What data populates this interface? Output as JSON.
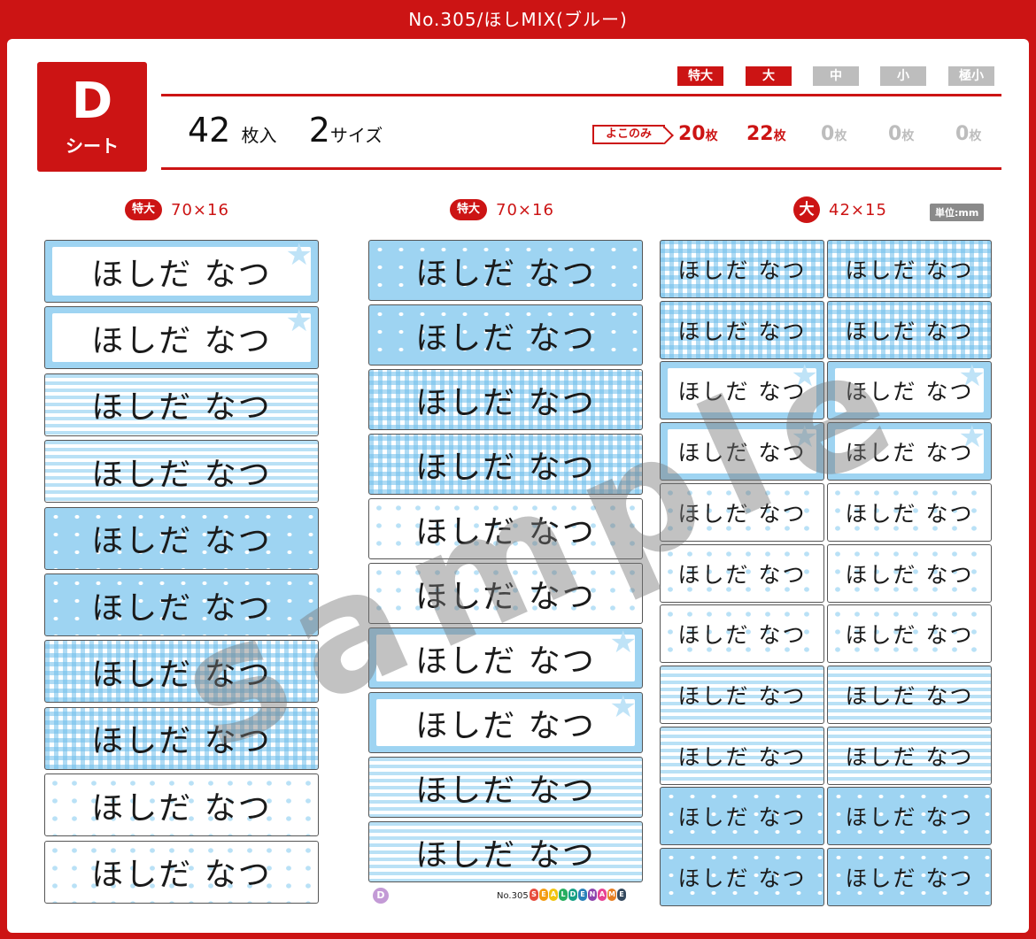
{
  "title": "No.305/ほしMIX(ブルー)",
  "sheet": {
    "letter": "D",
    "label": "シート"
  },
  "sizes": [
    {
      "label": "特大",
      "active": true
    },
    {
      "label": "大",
      "active": true
    },
    {
      "label": "中",
      "active": false
    },
    {
      "label": "小",
      "active": false
    },
    {
      "label": "極小",
      "active": false
    }
  ],
  "count": {
    "total": "42",
    "total_unit": "枚入",
    "sizes": "2",
    "sizes_unit": "サイズ"
  },
  "yoko_label": "よこのみ",
  "quantities": [
    {
      "value": "20",
      "unit": "枚",
      "active": true
    },
    {
      "value": "22",
      "unit": "枚",
      "active": true
    },
    {
      "value": "0",
      "unit": "枚",
      "active": false
    },
    {
      "value": "0",
      "unit": "枚",
      "active": false
    },
    {
      "value": "0",
      "unit": "枚",
      "active": false
    }
  ],
  "columns": [
    {
      "badge": "特大",
      "dim": "70×16"
    },
    {
      "badge": "特大",
      "dim": "70×16"
    },
    {
      "badge": "大",
      "dim": "42×15"
    }
  ],
  "unit_label": "単位:mm",
  "label_text": "ほしだ なつ",
  "col1_patterns": [
    "frame",
    "frame",
    "stripe",
    "stripe",
    "star",
    "star",
    "gingham",
    "gingham",
    "wstar",
    "wstar"
  ],
  "col2_patterns": [
    "star",
    "star",
    "gingham",
    "gingham",
    "wstar",
    "wstar",
    "frame",
    "frame",
    "stripe",
    "stripe"
  ],
  "col3_patterns": [
    "gingham",
    "gingham",
    "frame",
    "frame",
    "wstar",
    "wstar",
    "wstar",
    "stripe",
    "stripe",
    "star",
    "star"
  ],
  "watermark": "sample",
  "footer": {
    "sheet_letter": "D",
    "number": "No.305",
    "brand": "SEALDENAME"
  }
}
